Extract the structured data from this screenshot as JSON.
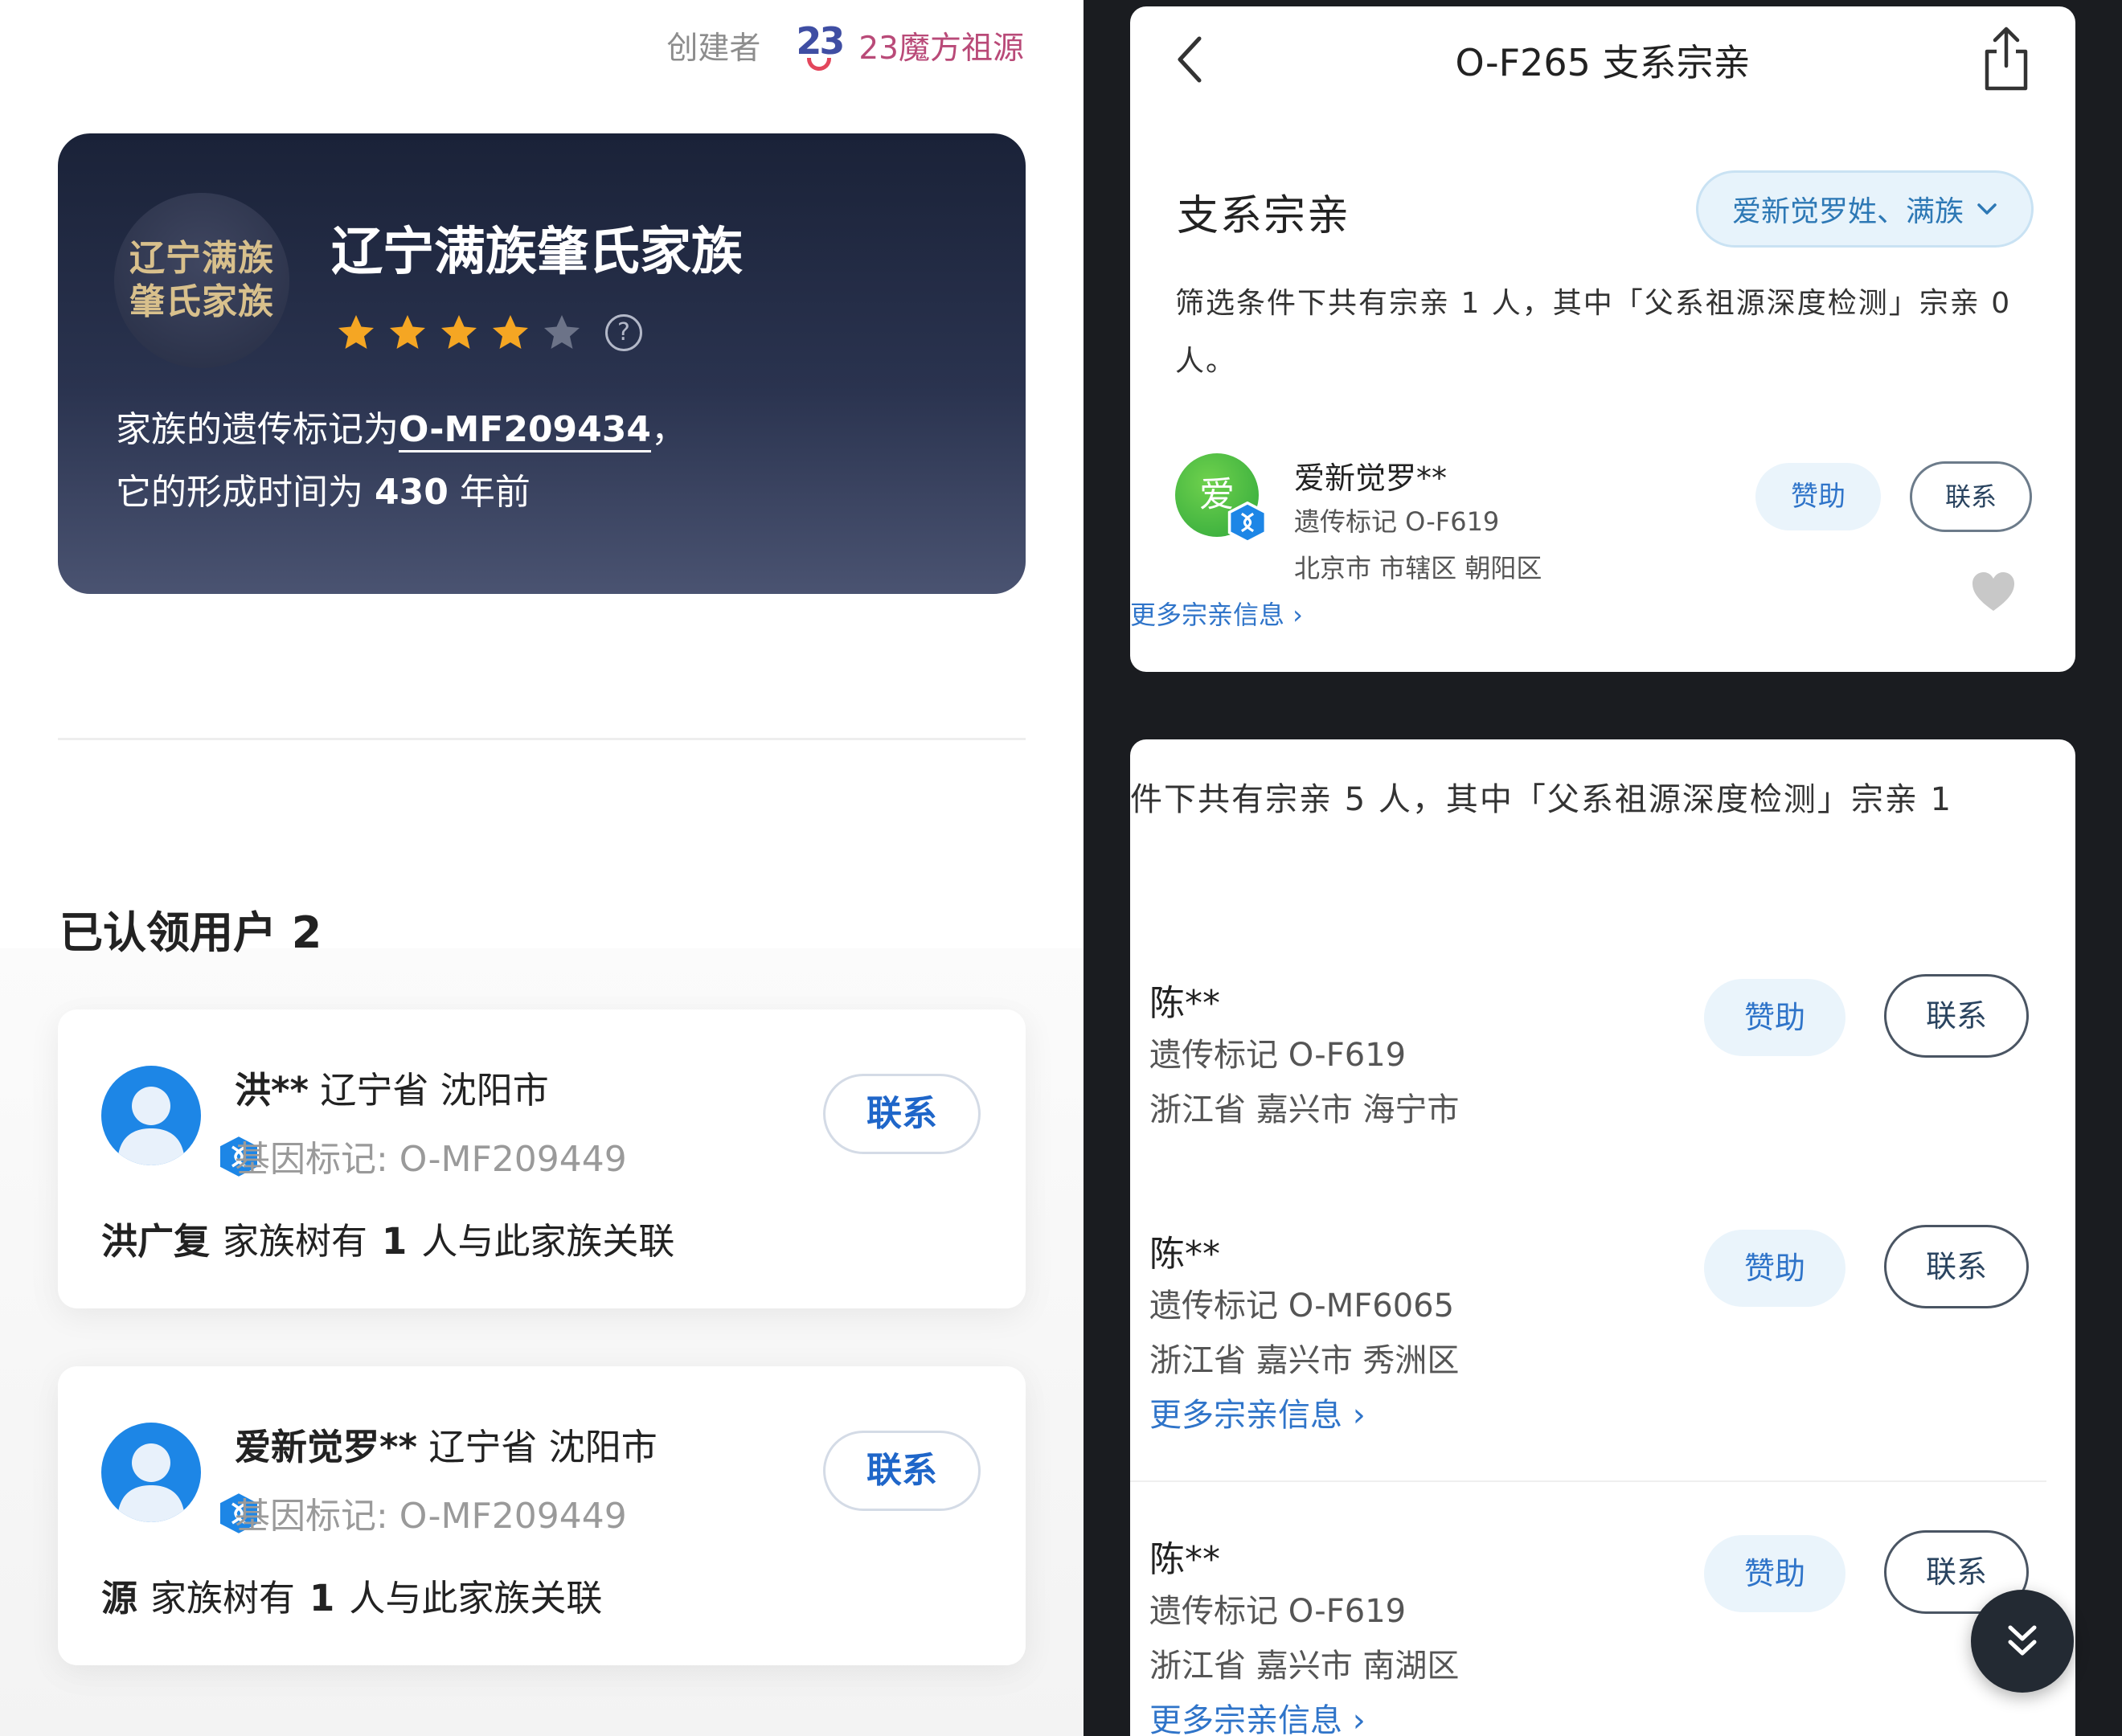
{
  "left": {
    "creator_label": "创建者",
    "creator_logo": "23",
    "creator_name": "23魔方祖源",
    "family": {
      "emblem_line1": "辽宁满族",
      "emblem_line2": "肇氏家族",
      "title": "辽宁满族肇氏家族",
      "rating": 4,
      "rating_max": 5,
      "desc_prefix": "家族的遗传标记为",
      "marker": "O-MF209434",
      "desc_suffix": "，",
      "desc2_prefix": "它的形成时间为",
      "years": "430",
      "desc2_suffix": "年前"
    },
    "claimed_title": "已认领用户 2",
    "users": [
      {
        "name": "洪**",
        "location": "辽宁省 沈阳市",
        "gene_marker": "基因标记: O-MF209449",
        "contact_label": "联系",
        "tree_name": "洪广复",
        "tree_prefix": "家族树有",
        "tree_count": "1",
        "tree_suffix": "人与此家族关联"
      },
      {
        "name": "爱新觉罗**",
        "location": "辽宁省 沈阳市",
        "gene_marker": "基因标记: O-MF209449",
        "contact_label": "联系",
        "tree_name": "源",
        "tree_prefix": "家族树有",
        "tree_count": "1",
        "tree_suffix": "人与此家族关联"
      }
    ]
  },
  "top_right": {
    "page_title": "O-F265 支系宗亲",
    "section_title": "支系宗亲",
    "filter_label": "爱新觉罗姓、满族",
    "summary": "筛选条件下共有宗亲 1 人，其中「父系祖源深度检测」宗亲 0 人。",
    "item": {
      "avatar_char": "爱",
      "name": "爱新觉罗**",
      "marker": "遗传标记 O-F619",
      "location": "北京市 市辖区 朝阳区",
      "more": "更多宗亲信息 ›",
      "sponsor_label": "赞助",
      "contact_label": "联系"
    }
  },
  "bottom_right": {
    "summary": "件下共有宗亲 5 人，其中「父系祖源深度检测」宗亲 1",
    "items": [
      {
        "name": "陈**",
        "marker": "遗传标记 O-F619",
        "location": "浙江省 嘉兴市 海宁市",
        "more": "",
        "sponsor_label": "赞助",
        "contact_label": "联系"
      },
      {
        "name": "陈**",
        "marker": "遗传标记 O-MF6065",
        "location": "浙江省 嘉兴市 秀洲区",
        "more": "更多宗亲信息 ›",
        "sponsor_label": "赞助",
        "contact_label": "联系"
      },
      {
        "name": "陈**",
        "marker": "遗传标记 O-F619",
        "location": "浙江省 嘉兴市 南湖区",
        "more": "更多宗亲信息 ›",
        "sponsor_label": "赞助",
        "contact_label": "联系"
      }
    ]
  },
  "colors": {
    "accent_blue": "#1f66c9",
    "card_dark": "#1a2238",
    "star": "#f5a623",
    "creator_name": "#b94a78"
  },
  "icons": [
    "back-icon",
    "share-icon",
    "chevron-down-icon",
    "star-icon",
    "help-icon",
    "dna-badge-icon",
    "heart-icon",
    "double-chevron-down-icon",
    "user-avatar-icon"
  ]
}
